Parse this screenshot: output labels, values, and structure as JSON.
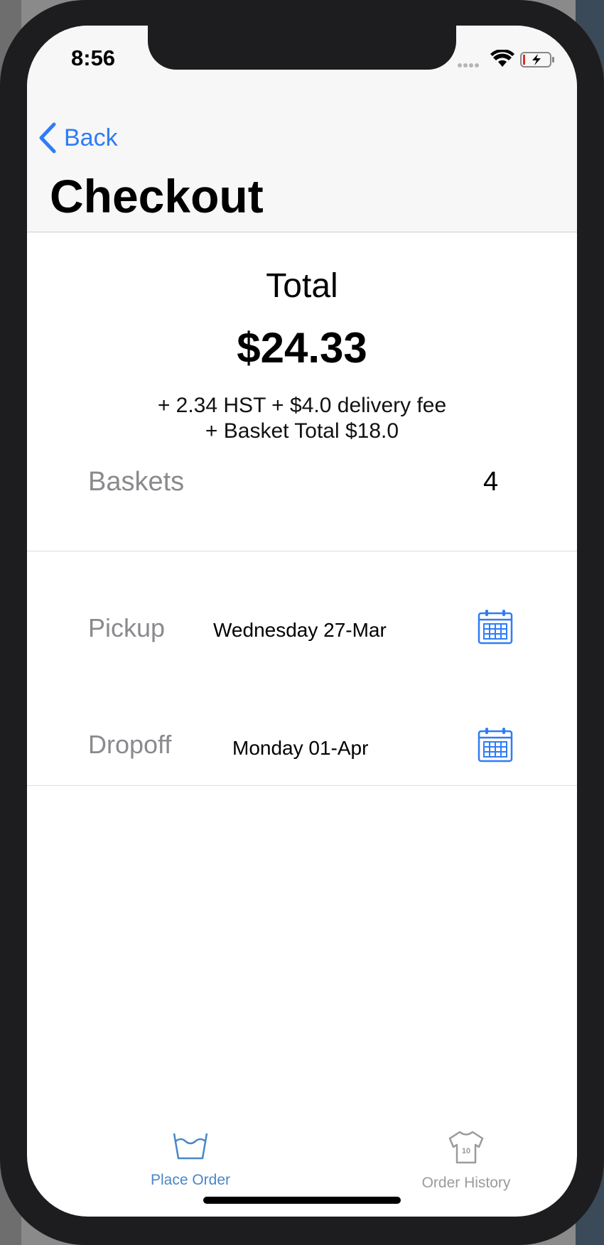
{
  "status": {
    "time": "8:56"
  },
  "nav": {
    "back_label": "Back",
    "title": "Checkout"
  },
  "summary": {
    "total_label": "Total",
    "total_amount": "$24.33",
    "breakdown_line1": "+ 2.34 HST + $4.0 delivery fee",
    "breakdown_line2": "+ Basket Total $18.0",
    "baskets_label": "Baskets",
    "baskets_value": "4"
  },
  "schedule": {
    "pickup_label": "Pickup",
    "pickup_date": "Wednesday 27-Mar",
    "dropoff_label": "Dropoff",
    "dropoff_date": "Monday 01-Apr"
  },
  "tabs": [
    {
      "label": "Place Order",
      "icon": "basket-icon",
      "active": true
    },
    {
      "label": "Order History",
      "icon": "jersey-icon",
      "active": false
    }
  ],
  "colors": {
    "accent": "#2f7cf6",
    "tab_active": "#4a86c8",
    "tab_inactive": "#9b9b9b",
    "label_gray": "#8a8a8e"
  }
}
